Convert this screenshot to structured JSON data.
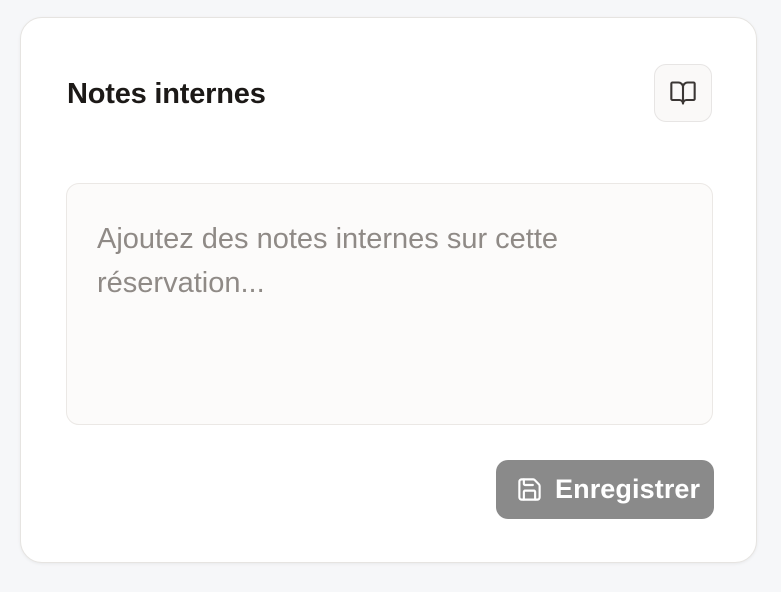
{
  "card": {
    "title": "Notes internes",
    "guide_icon": "book-open-icon"
  },
  "notes": {
    "value": "",
    "placeholder": "Ajoutez des notes internes sur cette réservation..."
  },
  "actions": {
    "save_label": "Enregistrer",
    "save_icon": "save-icon"
  },
  "colors": {
    "page_background": "#f6f7f9",
    "card_background": "#ffffff",
    "textarea_background": "#fcfbfa",
    "save_button_background": "#8a8a8a",
    "title_text": "#1c1917",
    "placeholder_text": "#8f8a86"
  }
}
